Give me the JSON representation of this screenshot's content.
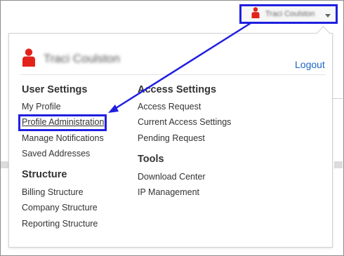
{
  "topbar": {
    "user_name": "Traci Coulston",
    "caret_icon": "chevron-down-icon",
    "user_icon": "person-icon"
  },
  "panel": {
    "user_name": "Traci Coulston",
    "logout_label": "Logout"
  },
  "sections": {
    "user_settings": {
      "title": "User Settings",
      "items": [
        "My Profile",
        "Profile Administration",
        "Manage Notifications",
        "Saved Addresses"
      ]
    },
    "structure": {
      "title": "Structure",
      "items": [
        "Billing Structure",
        "Company Structure",
        "Reporting Structure"
      ]
    },
    "access_settings": {
      "title": "Access Settings",
      "items": [
        "Access Request",
        "Current Access Settings",
        "Pending Request"
      ]
    },
    "tools": {
      "title": "Tools",
      "items": [
        "Download Center",
        "IP Management"
      ]
    }
  },
  "colors": {
    "annotation_blue": "#1f1fe0",
    "link_blue": "#1a66c5",
    "icon_red": "#e2231a"
  }
}
